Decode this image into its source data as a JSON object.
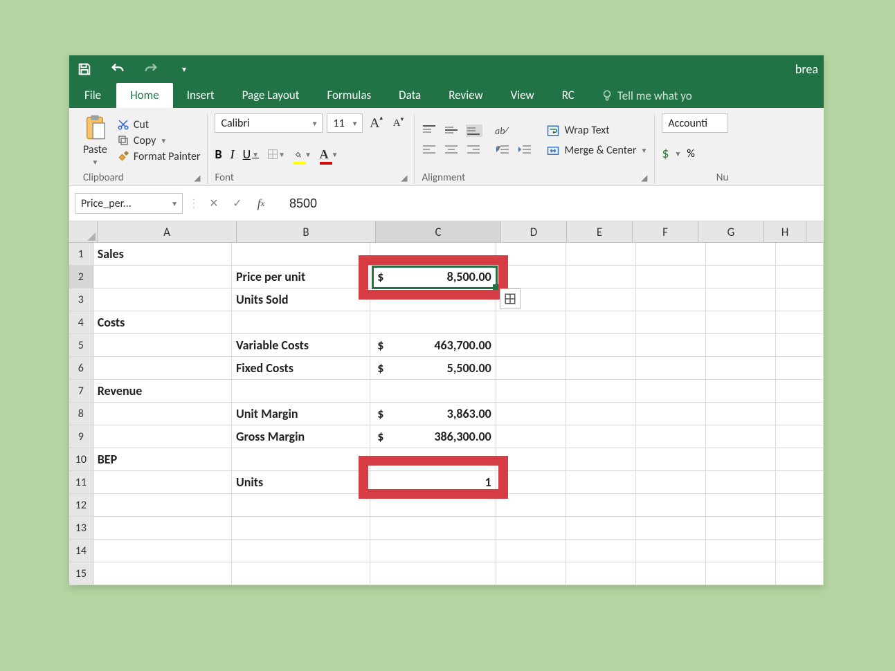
{
  "titlebar": {
    "doc_title": "brea"
  },
  "tabs": {
    "file": "File",
    "home": "Home",
    "insert": "Insert",
    "page_layout": "Page Layout",
    "formulas": "Formulas",
    "data": "Data",
    "review": "Review",
    "view": "View",
    "rc": "RC",
    "tellme": "Tell me what yo"
  },
  "clipboard": {
    "paste": "Paste",
    "cut": "Cut",
    "copy": "Copy",
    "format_painter": "Format Painter",
    "group_label": "Clipboard"
  },
  "font": {
    "name": "Calibri",
    "size": "11",
    "group_label": "Font",
    "b": "B",
    "i": "I",
    "u": "U",
    "bigA": "A",
    "smallA": "A",
    "letterA": "A"
  },
  "alignment": {
    "wrap": "Wrap Text",
    "merge": "Merge & Center",
    "group_label": "Alignment"
  },
  "number": {
    "format": "Accounti",
    "dollar": "$",
    "percent": "%",
    "group_label": "Nu"
  },
  "namebox": "Price_per...",
  "formula_value": "8500",
  "columns": [
    "A",
    "B",
    "C",
    "D",
    "E",
    "F",
    "G",
    "H"
  ],
  "rows": [
    {
      "n": "1",
      "a": "Sales",
      "b": "",
      "c_sym": "",
      "c_val": ""
    },
    {
      "n": "2",
      "a": "",
      "b": "Price per unit",
      "c_sym": "$",
      "c_val": "8,500.00",
      "selected": true
    },
    {
      "n": "3",
      "a": "",
      "b": "Units Sold",
      "c_sym": "",
      "c_val": ""
    },
    {
      "n": "4",
      "a": "Costs",
      "b": "",
      "c_sym": "",
      "c_val": ""
    },
    {
      "n": "5",
      "a": "",
      "b": "Variable Costs",
      "c_sym": "$",
      "c_val": "463,700.00"
    },
    {
      "n": "6",
      "a": "",
      "b": "Fixed Costs",
      "c_sym": "$",
      "c_val": "5,500.00"
    },
    {
      "n": "7",
      "a": "Revenue",
      "b": "",
      "c_sym": "",
      "c_val": ""
    },
    {
      "n": "8",
      "a": "",
      "b": "Unit Margin",
      "c_sym": "$",
      "c_val": "3,863.00"
    },
    {
      "n": "9",
      "a": "",
      "b": "Gross Margin",
      "c_sym": "$",
      "c_val": "386,300.00"
    },
    {
      "n": "10",
      "a": "BEP",
      "b": "",
      "c_sym": "",
      "c_val": ""
    },
    {
      "n": "11",
      "a": "",
      "b": "Units",
      "c_sym": "",
      "c_val": "1",
      "num_right": true
    },
    {
      "n": "12",
      "a": "",
      "b": "",
      "c_sym": "",
      "c_val": ""
    },
    {
      "n": "13",
      "a": "",
      "b": "",
      "c_sym": "",
      "c_val": ""
    },
    {
      "n": "14",
      "a": "",
      "b": "",
      "c_sym": "",
      "c_val": ""
    },
    {
      "n": "15",
      "a": "",
      "b": "",
      "c_sym": "",
      "c_val": ""
    }
  ]
}
